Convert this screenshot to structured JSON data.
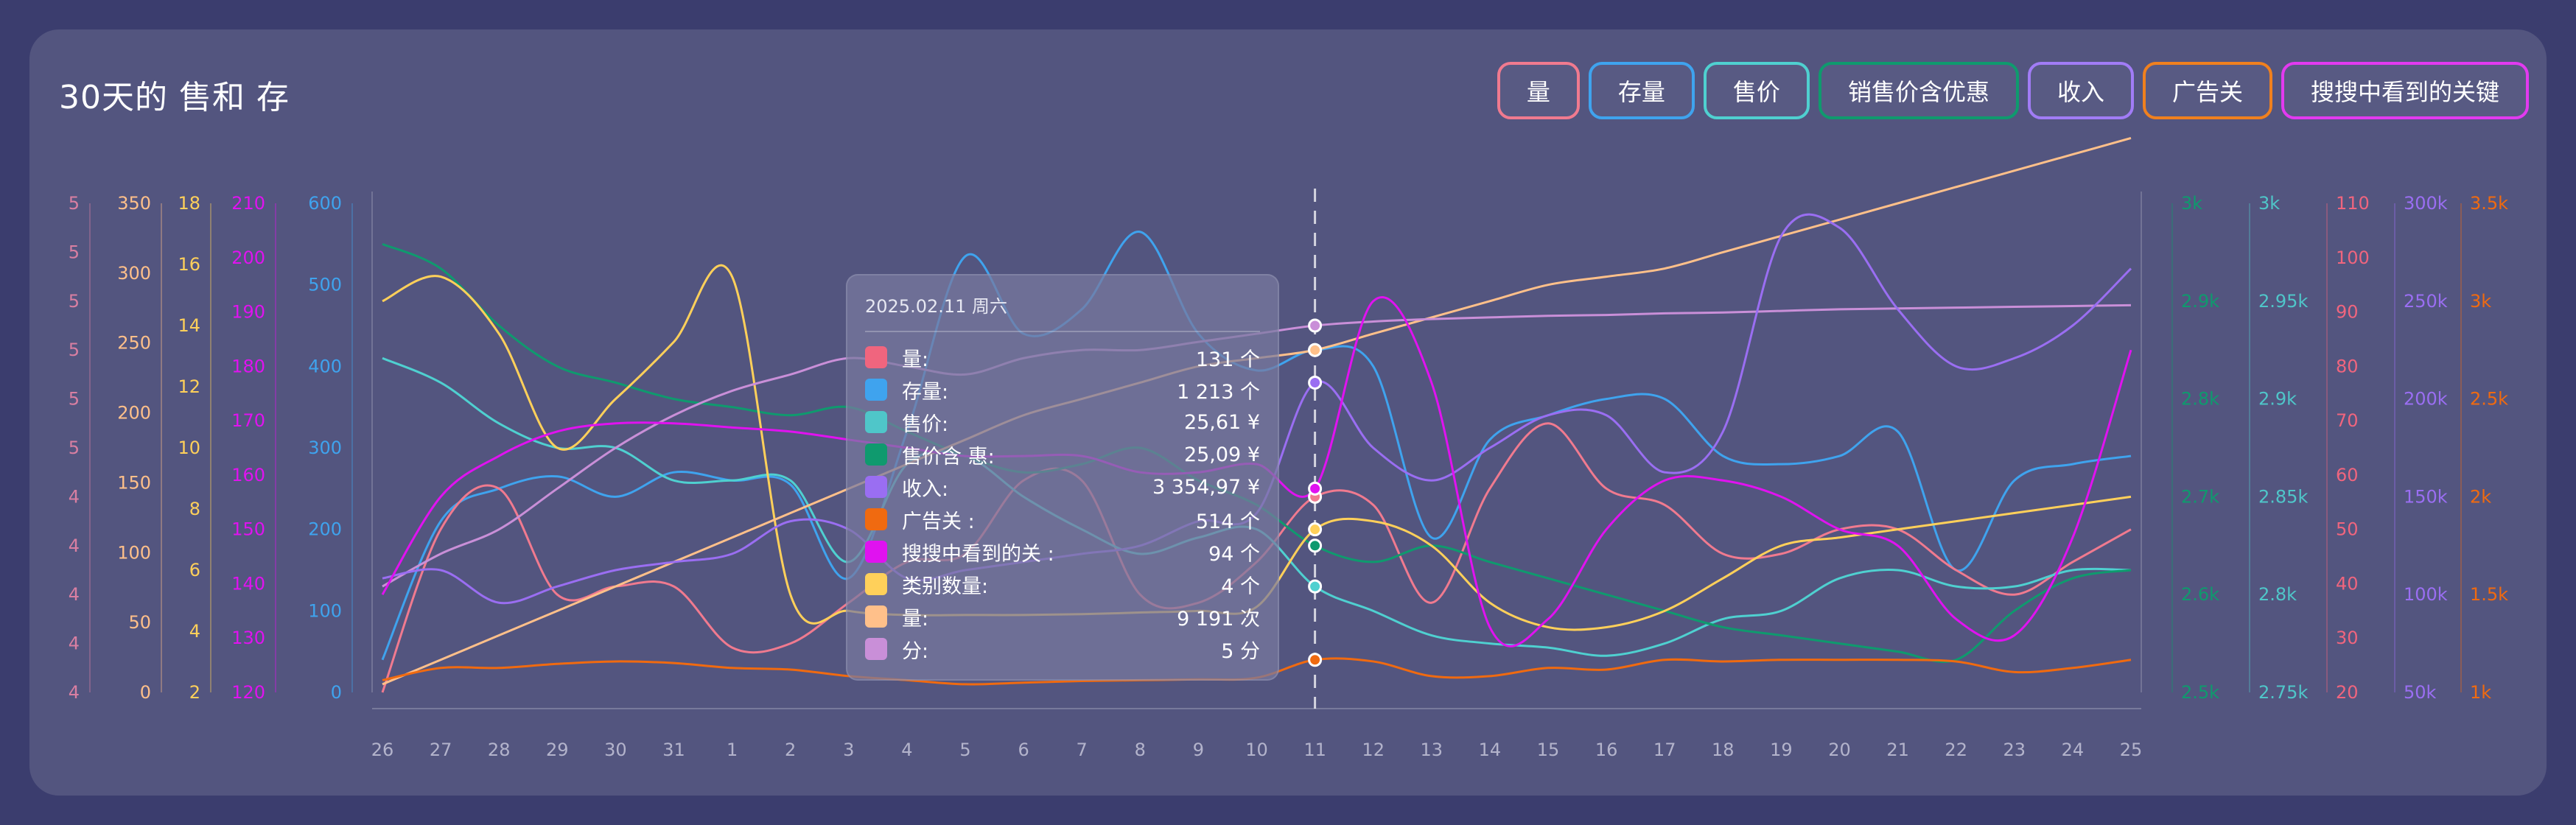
{
  "title": "30天的  售和  存",
  "pills": [
    {
      "label": "  量",
      "color": "#f07a8f"
    },
    {
      "label": "存量",
      "color": "#3fa3ee"
    },
    {
      "label": "售价",
      "color": "#4fd0d0"
    },
    {
      "label": "销售价含优惠",
      "color": "#0f9a6e"
    },
    {
      "label": "收入",
      "color": "#a17cf6"
    },
    {
      "label": "广告关",
      "color": "#f0801e"
    },
    {
      "label": "搜搜中看到的关键",
      "color": "#e23af0"
    }
  ],
  "tooltip": {
    "date": "2025.02.11 周六",
    "rows": [
      {
        "label": "  量:",
        "value": "131 个",
        "color": "#f0657e"
      },
      {
        "label": "存量:",
        "value": "1 213 个",
        "color": "#3fa3ee"
      },
      {
        "label": "售价:",
        "value": "25,61 ¥",
        "color": "#4fc6c9"
      },
      {
        "label": "售价含  惠:",
        "value": "25,09 ¥",
        "color": "#0f9a6e"
      },
      {
        "label": "收入:",
        "value": "3 354,97 ¥",
        "color": "#9a6ef2"
      },
      {
        "label": "广告关    :",
        "value": "514 个",
        "color": "#f06a10"
      },
      {
        "label": "搜搜中看到的关    :",
        "value": "94 个",
        "color": "#e012f0"
      },
      {
        "label": "类别数量:",
        "value": "4 个",
        "color": "#ffd05a"
      },
      {
        "label": "  量:",
        "value": "9 191 次",
        "color": "#ffc08a"
      },
      {
        "label": "  分:",
        "value": "5 分",
        "color": "#c98fd8"
      }
    ]
  },
  "chart_data": {
    "type": "line",
    "categories": [
      "26",
      "27",
      "28",
      "29",
      "30",
      "31",
      "1",
      "2",
      "3",
      "4",
      "5",
      "6",
      "7",
      "8",
      "9",
      "10",
      "11",
      "12",
      "13",
      "14",
      "15",
      "16",
      "17",
      "18",
      "19",
      "20",
      "21",
      "22",
      "23",
      "24",
      "25"
    ],
    "highlight_index": 16,
    "left_axes": [
      {
        "color": "#d97fa2",
        "ticks": [
          "4",
          "4",
          "4",
          "4",
          "4",
          "5",
          "5",
          "5",
          "5",
          "5",
          "5"
        ],
        "min": 0,
        "max": 10
      },
      {
        "color": "#ffc08a",
        "ticks": [
          "0",
          "50",
          "100",
          "150",
          "200",
          "250",
          "300",
          "350"
        ],
        "min": 0,
        "max": 350
      },
      {
        "color": "#ffd05a",
        "ticks": [
          "2",
          "4",
          "6",
          "8",
          "10",
          "12",
          "14",
          "16",
          "18"
        ],
        "min": 2,
        "max": 18
      },
      {
        "color": "#e012f0",
        "ticks": [
          "120",
          "130",
          "140",
          "150",
          "160",
          "170",
          "180",
          "190",
          "200",
          "210"
        ],
        "min": 120,
        "max": 210
      },
      {
        "color": "#3fa3ee",
        "ticks": [
          "0",
          "100",
          "200",
          "300",
          "400",
          "500",
          "600"
        ],
        "min": 0,
        "max": 600
      }
    ],
    "right_axes": [
      {
        "color": "#0f9a6e",
        "ticks": [
          "2.5k",
          "2.6k",
          "2.7k",
          "2.8k",
          "2.9k",
          "3k"
        ],
        "min": 2500,
        "max": 3000
      },
      {
        "color": "#4fc6c9",
        "ticks": [
          "2.75k",
          "2.8k",
          "2.85k",
          "2.9k",
          "2.95k",
          "3k"
        ],
        "min": 2750,
        "max": 3000
      },
      {
        "color": "#f0657e",
        "ticks": [
          "20",
          "30",
          "40",
          "50",
          "60",
          "70",
          "80",
          "90",
          "100",
          "110"
        ],
        "min": 20,
        "max": 110
      },
      {
        "color": "#9a6ef2",
        "ticks": [
          "50k",
          "100k",
          "150k",
          "200k",
          "250k",
          "300k"
        ],
        "min": 50000,
        "max": 300000
      },
      {
        "color": "#f06a10",
        "ticks": [
          "1k",
          "1.5k",
          "2k",
          "2.5k",
          "3k",
          "3.5k"
        ],
        "min": 1000,
        "max": 3500
      }
    ],
    "series": [
      {
        "color": "#3fa3ee",
        "values": [
          40,
          210,
          250,
          265,
          240,
          270,
          260,
          255,
          140,
          320,
          535,
          440,
          470,
          565,
          440,
          395,
          420,
          400,
          190,
          310,
          340,
          360,
          360,
          290,
          280,
          290,
          320,
          150,
          260,
          280,
          290
        ]
      },
      {
        "color": "#f07a8f",
        "values": [
          0,
          200,
          250,
          120,
          130,
          130,
          55,
          60,
          110,
          160,
          170,
          260,
          260,
          120,
          110,
          160,
          240,
          230,
          110,
          250,
          330,
          250,
          230,
          170,
          170,
          200,
          200,
          150,
          120,
          160,
          200
        ]
      },
      {
        "color": "#4fd0d0",
        "values": [
          410,
          380,
          330,
          300,
          300,
          260,
          260,
          260,
          160,
          280,
          290,
          240,
          200,
          170,
          190,
          200,
          130,
          100,
          70,
          60,
          55,
          45,
          60,
          90,
          100,
          140,
          150,
          130,
          130,
          150,
          150
        ]
      },
      {
        "color": "#0f9a6e",
        "values": [
          550,
          520,
          450,
          400,
          380,
          360,
          350,
          340,
          350,
          320,
          290,
          270,
          280,
          300,
          260,
          230,
          180,
          160,
          180,
          160,
          140,
          120,
          100,
          80,
          70,
          60,
          50,
          40,
          100,
          140,
          150
        ]
      },
      {
        "color": "#ffd05a",
        "values": [
          480,
          510,
          440,
          300,
          360,
          430,
          510,
          120,
          100,
          95,
          95,
          95,
          96,
          98,
          100,
          105,
          200,
          210,
          180,
          110,
          80,
          80,
          100,
          140,
          180,
          190,
          200,
          210,
          220,
          230,
          240
        ]
      },
      {
        "color": "#ffc08a",
        "values": [
          10,
          40,
          70,
          100,
          130,
          160,
          190,
          220,
          250,
          280,
          310,
          340,
          360,
          380,
          400,
          410,
          420,
          440,
          460,
          480,
          500,
          510,
          520,
          540,
          560,
          580,
          600,
          620,
          640,
          660,
          680
        ]
      },
      {
        "color": "#c98fd8",
        "values": [
          130,
          170,
          200,
          250,
          300,
          340,
          370,
          390,
          410,
          400,
          390,
          410,
          420,
          420,
          430,
          440,
          450,
          455,
          458,
          460,
          462,
          463,
          465,
          466,
          468,
          470,
          471,
          472,
          473,
          474,
          475
        ]
      },
      {
        "color": "#9a6ef2",
        "values": [
          140,
          150,
          110,
          130,
          150,
          160,
          170,
          210,
          200,
          140,
          150,
          160,
          170,
          180,
          210,
          220,
          380,
          300,
          260,
          300,
          340,
          340,
          270,
          320,
          560,
          570,
          470,
          400,
          410,
          450,
          520
        ]
      },
      {
        "color": "#f06a10",
        "values": [
          15,
          30,
          30,
          35,
          38,
          36,
          30,
          28,
          20,
          15,
          10,
          12,
          14,
          15,
          16,
          18,
          40,
          38,
          20,
          20,
          30,
          28,
          40,
          38,
          40,
          40,
          40,
          38,
          25,
          30,
          40
        ]
      },
      {
        "color": "#e012f0",
        "values": [
          120,
          240,
          290,
          320,
          330,
          330,
          325,
          320,
          310,
          300,
          290,
          290,
          290,
          270,
          270,
          280,
          250,
          480,
          380,
          80,
          90,
          200,
          260,
          260,
          240,
          200,
          180,
          90,
          70,
          190,
          420
        ]
      }
    ]
  }
}
